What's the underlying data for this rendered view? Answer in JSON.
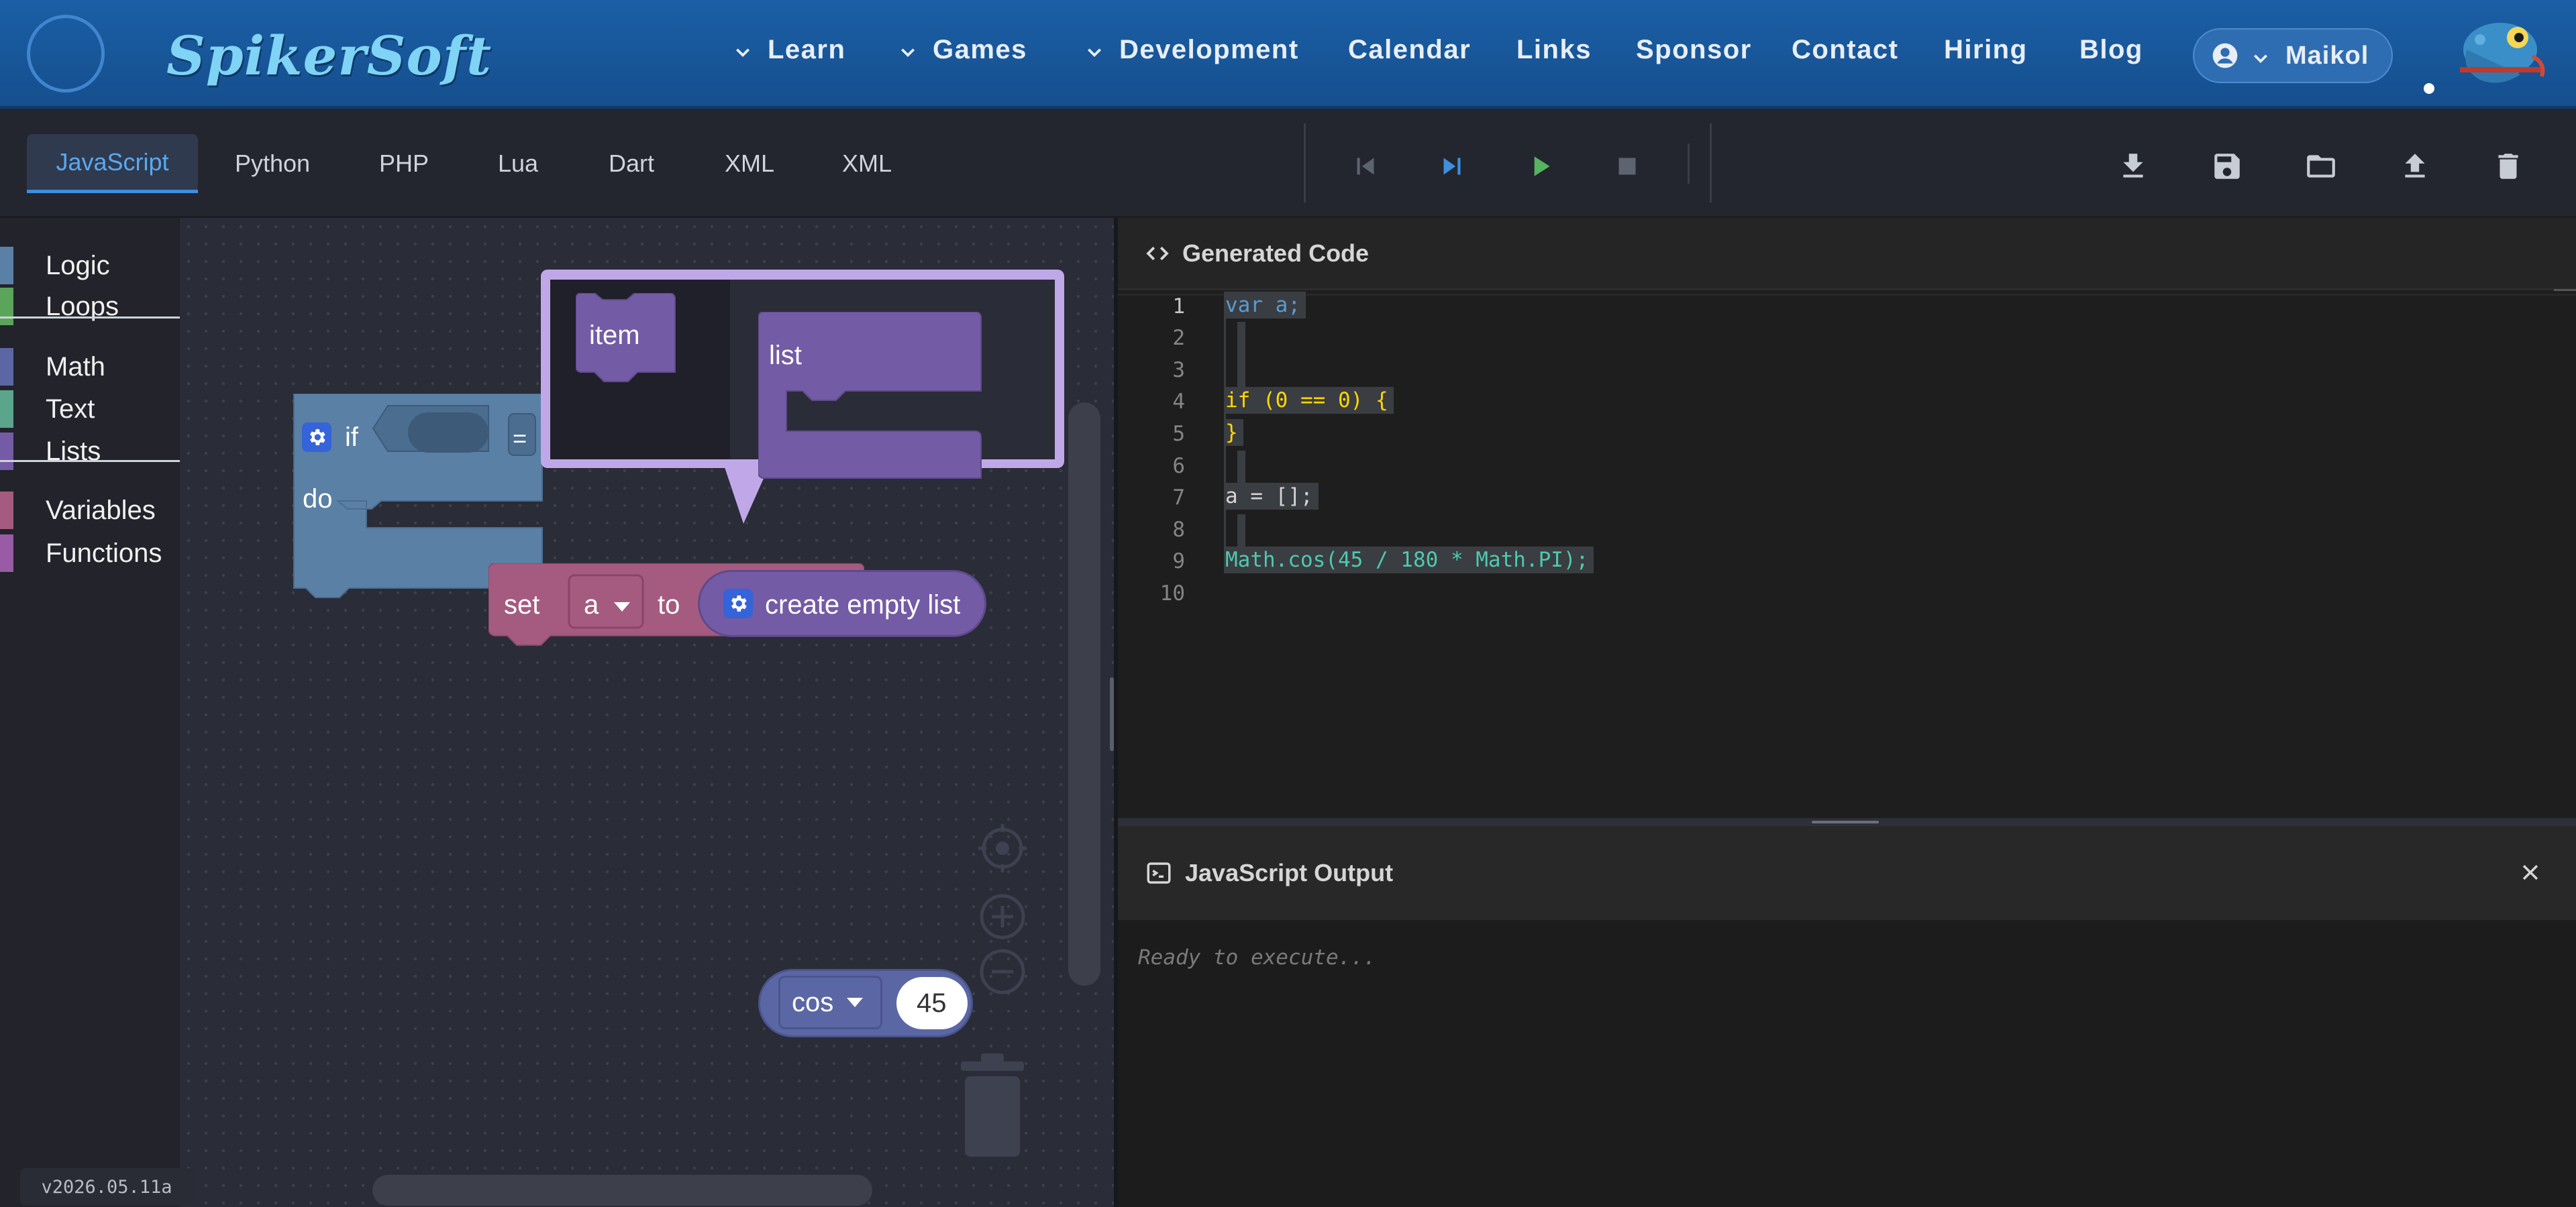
{
  "header": {
    "brand": "SpikerSoft",
    "nav": [
      "Learn",
      "Games",
      "Development",
      "Calendar",
      "Links",
      "Sponsor",
      "Contact",
      "Hiring",
      "Blog"
    ],
    "user": "Maikol"
  },
  "tabs": [
    "JavaScript",
    "Python",
    "PHP",
    "Lua",
    "Dart",
    "XML",
    "XML"
  ],
  "active_tab": "JavaScript",
  "toolbar_icons": [
    "skip-previous-icon",
    "step-forward-icon",
    "play-icon",
    "stop-icon",
    "download-icon",
    "save-icon",
    "folder-icon",
    "upload-icon",
    "trash-icon"
  ],
  "categories": [
    {
      "label": "Logic",
      "color": "#5b80a5"
    },
    {
      "label": "Loops",
      "color": "#5ba55b"
    },
    {
      "label": "Math",
      "color": "#5b67a5"
    },
    {
      "label": "Text",
      "color": "#5ba58c"
    },
    {
      "label": "Lists",
      "color": "#745ba5"
    },
    {
      "label": "Variables",
      "color": "#a55b80"
    },
    {
      "label": "Functions",
      "color": "#995ba5"
    }
  ],
  "version": "v2026.05.11a",
  "blocks": {
    "if_label": "if",
    "do_label": "do",
    "eq_op": "=",
    "set_label": "set",
    "var_name": "a",
    "to_label": "to",
    "create_list": "create empty list",
    "mutator_item": "item",
    "mutator_list": "list",
    "cos_label": "cos",
    "cos_value": "45"
  },
  "code_panel": {
    "title": "Generated Code",
    "line_numbers": [
      "1",
      "2",
      "3",
      "4",
      "5",
      "6",
      "7",
      "8",
      "9",
      "10"
    ],
    "lines": [
      "var a;",
      "",
      "",
      "if (0 == 0) {",
      "}",
      "",
      "a = [];",
      "",
      "Math.cos(45 / 180 * Math.PI);",
      ""
    ]
  },
  "output_panel": {
    "title": "JavaScript Output",
    "status": "Ready to execute..."
  },
  "colors": {
    "header": "#1b5fa6",
    "accent": "#3d8fe0",
    "logic_block": "#5b80a5",
    "variables_block": "#a55b80",
    "lists_block": "#745ba5",
    "math_block": "#5b67a5"
  }
}
